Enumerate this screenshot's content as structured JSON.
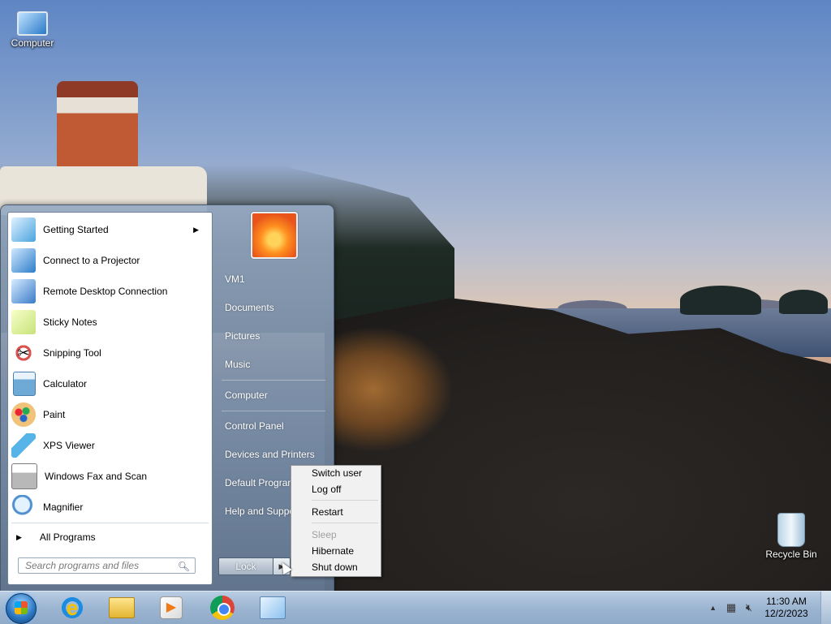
{
  "desktop": {
    "icons": [
      {
        "label": "Computer",
        "icon": "computer-icon"
      },
      {
        "label": "Recycle Bin",
        "icon": "recycle-bin-icon"
      }
    ]
  },
  "start_menu": {
    "programs": [
      {
        "label": "Getting Started",
        "icon": "getting-started-icon",
        "color": "#4aa3df",
        "has_submenu": true
      },
      {
        "label": "Connect to a Projector",
        "icon": "projector-icon",
        "color": "#2d7dc8",
        "has_submenu": false
      },
      {
        "label": "Remote Desktop Connection",
        "icon": "remote-desktop-icon",
        "color": "#3a7bc8",
        "has_submenu": false
      },
      {
        "label": "Sticky Notes",
        "icon": "sticky-notes-icon",
        "color": "#c7e27a",
        "has_submenu": false
      },
      {
        "label": "Snipping Tool",
        "icon": "scissors-icon",
        "color": "#d9534f",
        "has_submenu": false
      },
      {
        "label": "Calculator",
        "icon": "calculator-icon",
        "color": "#6fa9d6",
        "has_submenu": false
      },
      {
        "label": "Paint",
        "icon": "paint-palette-icon",
        "color": "#e8a33a",
        "has_submenu": false
      },
      {
        "label": "XPS Viewer",
        "icon": "xps-viewer-icon",
        "color": "#56b4e9",
        "has_submenu": false
      },
      {
        "label": "Windows Fax and Scan",
        "icon": "fax-icon",
        "color": "#9a9a9a",
        "has_submenu": false
      },
      {
        "label": "Magnifier",
        "icon": "magnifier-icon",
        "color": "#4f8fcf",
        "has_submenu": false
      }
    ],
    "all_programs_label": "All Programs",
    "search_placeholder": "Search programs and files",
    "right_items": [
      {
        "label": "VM1"
      },
      {
        "label": "Documents"
      },
      {
        "label": "Pictures"
      },
      {
        "label": "Music"
      },
      {
        "label": "Computer"
      },
      {
        "label": "Control Panel"
      },
      {
        "label": "Devices and Printers"
      },
      {
        "label": "Default Programs"
      },
      {
        "label": "Help and Support"
      }
    ],
    "lock_label": "Lock"
  },
  "power_menu": {
    "items": [
      {
        "label": "Switch user",
        "enabled": true
      },
      {
        "label": "Log off",
        "enabled": true
      },
      {
        "label": "Restart",
        "enabled": true
      },
      {
        "label": "Sleep",
        "enabled": false
      },
      {
        "label": "Hibernate",
        "enabled": true
      },
      {
        "label": "Shut down",
        "enabled": true
      }
    ]
  },
  "taskbar": {
    "pinned": [
      {
        "name": "internet-explorer-icon"
      },
      {
        "name": "file-explorer-icon"
      },
      {
        "name": "media-player-icon"
      },
      {
        "name": "chrome-icon"
      },
      {
        "name": "control-panel-icon"
      }
    ],
    "clock": {
      "time": "11:30 AM",
      "date": "12/2/2023"
    }
  }
}
